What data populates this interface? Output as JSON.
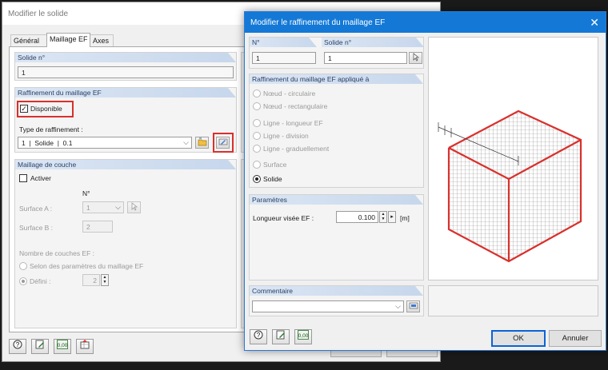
{
  "back_dialog": {
    "title": "Modifier le solide",
    "tabs": [
      "Général",
      "Maillage EF",
      "Axes"
    ],
    "solid_section": {
      "header": "Solide n°",
      "value": "1"
    },
    "refinement_section": {
      "header": "Raffinement du maillage EF",
      "available_label": "Disponible",
      "available_checked": true,
      "type_label": "Type de raffinement :",
      "type_value": "1  |  Solide  |  0.1"
    },
    "layer_section": {
      "header": "Maillage de couche",
      "activate_label": "Activer",
      "activate_checked": false,
      "col_no": "N°",
      "surface_a_label": "Surface A :",
      "surface_a_value": "1",
      "surface_b_label": "Surface B :",
      "surface_b_value": "2",
      "layers_label": "Nombre de couches EF :",
      "option_mesh_params": "Selon des paramètres du maillage EF",
      "option_defined": "Défini :",
      "defined_value": "2"
    }
  },
  "front_dialog": {
    "title": "Modifier le raffinement du maillage EF",
    "no_label": "N°",
    "no_value": "1",
    "solid_label": "Solide n°",
    "solid_value": "1",
    "applied_header": "Raffinement du maillage EF appliqué à",
    "options": [
      {
        "label": "Nœud - circulaire",
        "selected": false,
        "enabled": false
      },
      {
        "label": "Nœud - rectangulaire",
        "selected": false,
        "enabled": false
      },
      {
        "label": "Ligne - longueur EF",
        "selected": false,
        "enabled": false
      },
      {
        "label": "Ligne - division",
        "selected": false,
        "enabled": false
      },
      {
        "label": "Ligne - graduellement",
        "selected": false,
        "enabled": false
      },
      {
        "label": "Surface",
        "selected": false,
        "enabled": false
      },
      {
        "label": "Solide",
        "selected": true,
        "enabled": true
      }
    ],
    "params_header": "Paramètres",
    "length_label": "Longueur visée EF :",
    "length_value": "0.100",
    "length_unit": "[m]",
    "comment_header": "Commentaire",
    "comment_value": "",
    "ok_label": "OK",
    "cancel_label": "Annuler"
  },
  "colors": {
    "accent": "#1479d6",
    "highlight_red": "#d9302c",
    "section_header": "#c7d7ec"
  }
}
